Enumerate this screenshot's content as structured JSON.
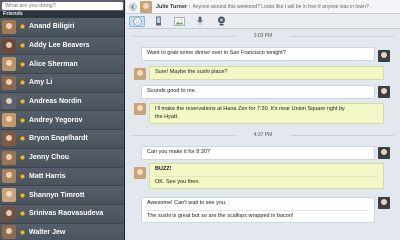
{
  "status": {
    "placeholder": "What are you doing?"
  },
  "friends": {
    "header": "Friends",
    "items": [
      {
        "name": "Anand Biligiri",
        "avatar_color": "#a07a52"
      },
      {
        "name": "Addy Lee Beavers",
        "avatar_color": "#6b4a36"
      },
      {
        "name": "Alice Sherman",
        "avatar_color": "#b8926a"
      },
      {
        "name": "Amy Li",
        "avatar_color": "#8a6a4e"
      },
      {
        "name": "Andreas Nordin",
        "avatar_color": "#5d6470"
      },
      {
        "name": "Andrey Yegorov",
        "avatar_color": "#c49a6c"
      },
      {
        "name": "Bryon Engelhardt",
        "avatar_color": "#7d5a40"
      },
      {
        "name": "Jenny Chou",
        "avatar_color": "#9a7455"
      },
      {
        "name": "Matt Harris",
        "avatar_color": "#a8845e"
      },
      {
        "name": "Shannyn Timrott",
        "avatar_color": "#c9a27e"
      },
      {
        "name": "Srinivas Raovasudeva",
        "avatar_color": "#6f5140"
      },
      {
        "name": "Walter Jew",
        "avatar_color": "#8c6d52"
      }
    ],
    "presence_color": "#f3c62f"
  },
  "chat": {
    "contact_name": "Julie Turner",
    "contact_status": "Anyone around this weekend? Looks like I will be in free if anyone was in town?",
    "timestamps": [
      "3:03 PM",
      "4:37 PM"
    ],
    "messages": [
      {
        "dir": "in",
        "lines": [
          "Want to grab some dinner over in San Francisco tonight?"
        ]
      },
      {
        "dir": "out",
        "lines": [
          "Sure! Maybe the sushi place?"
        ]
      },
      {
        "dir": "in",
        "lines": [
          "Sounds good to me."
        ]
      },
      {
        "dir": "out",
        "lines": [
          "I'll make the reservations at Hana Zen for 7:30. It's near Union Square right by",
          "the Hyatt."
        ]
      },
      {
        "dir": "in",
        "lines": [
          "Can you make it for 8:30?"
        ]
      },
      {
        "dir": "out",
        "lines": [
          "BUZZ!",
          "OK. See you then."
        ]
      },
      {
        "dir": "in",
        "lines": [
          "Awesome! Can't wait to see you.",
          "The sushi is great but so are the scallops wrapped in bacon!"
        ]
      }
    ]
  },
  "icons": {
    "back": "arrow-left-icon",
    "toolbar": [
      "emoticon-icon",
      "phone-icon",
      "photo-icon",
      "microphone-icon",
      "webcam-icon"
    ]
  }
}
